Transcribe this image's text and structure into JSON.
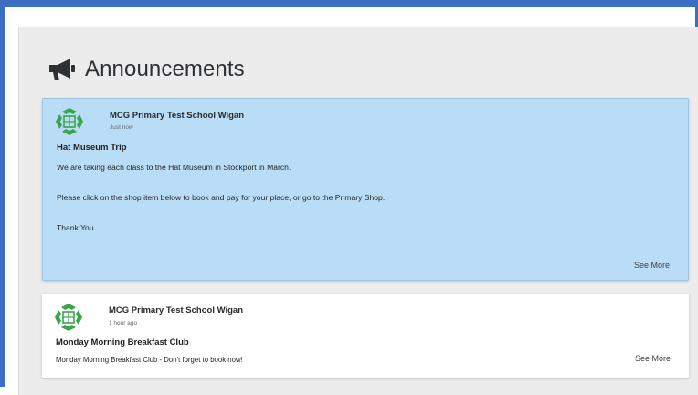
{
  "section": {
    "title": "Announcements",
    "icon": "megaphone-icon"
  },
  "announcements": [
    {
      "school": "MCG Primary Test School Wigan",
      "time": "Just now",
      "title": "Hat Museum Trip",
      "body": [
        "We are taking each class to the Hat Museum in Stockport in March.",
        "Please click on the shop item below to book and pay for your place, or go to the Primary Shop.",
        "Thank You"
      ],
      "see_more": "See More",
      "highlighted": true
    },
    {
      "school": "MCG Primary Test School Wigan",
      "time": "1 hour ago",
      "title": "Monday Morning Breakfast Club",
      "body": [
        "Monday Morning Breakfast Club - Don't forget to book now!"
      ],
      "see_more": "See More",
      "highlighted": false
    }
  ],
  "colors": {
    "frame_border": "#3a6fc4",
    "highlight_card": "#b9dcf7",
    "logo_green": "#3aa64a"
  }
}
